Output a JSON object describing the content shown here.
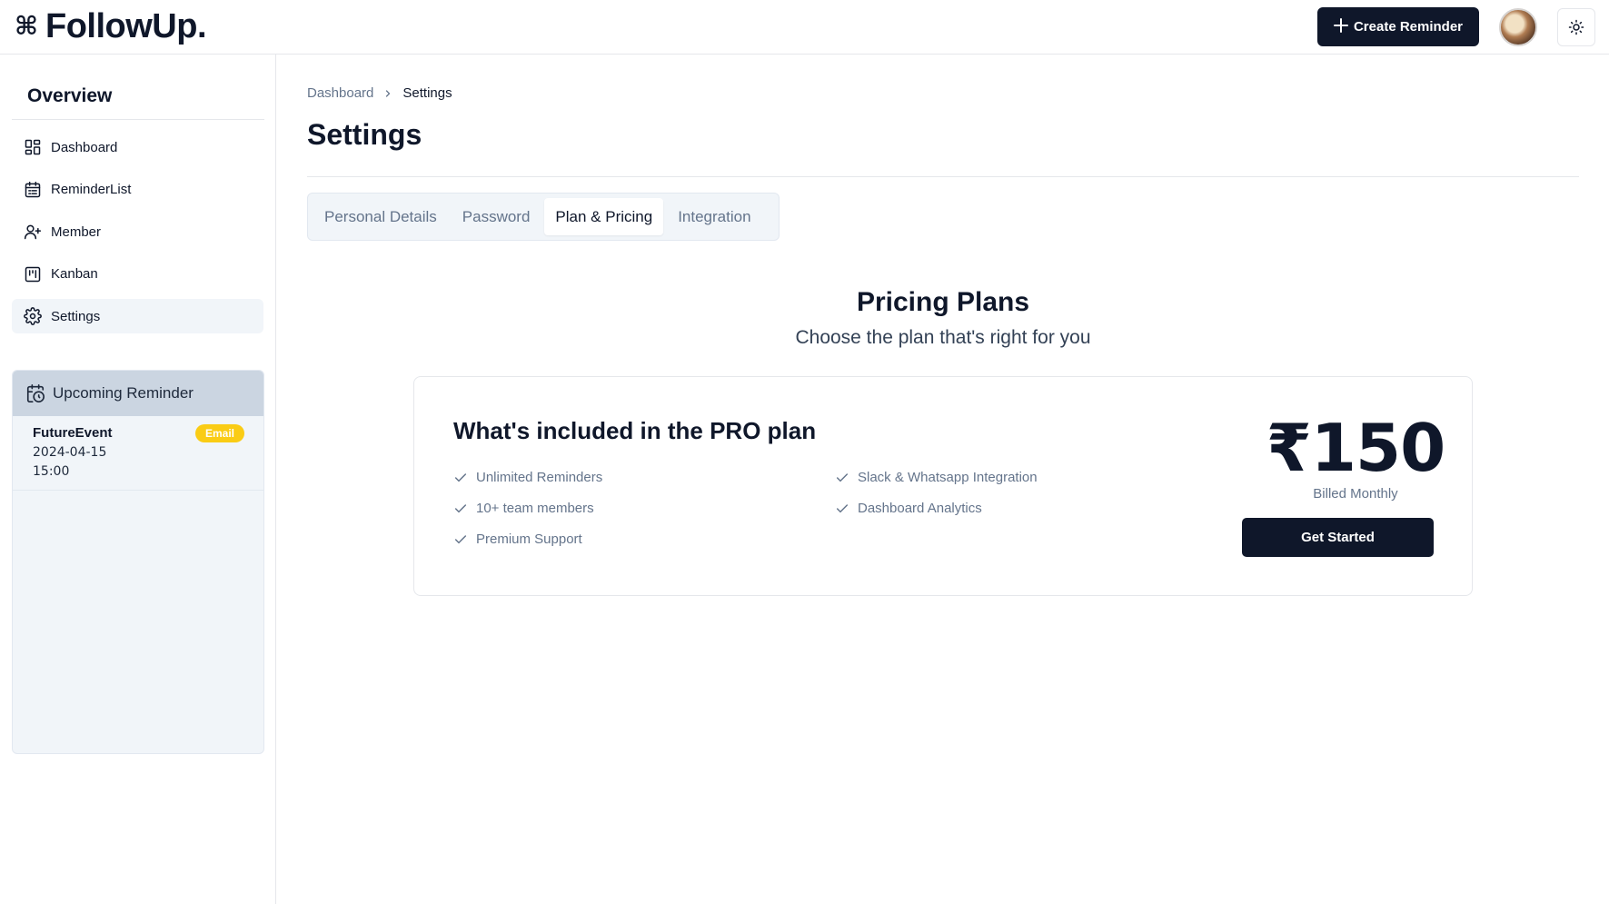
{
  "header": {
    "brand_symbol": "⌘",
    "brand_name": "FollowUp.",
    "create_button_icon": "plus-icon",
    "create_button_label": "Create Reminder",
    "theme_toggle_icon": "sun-icon"
  },
  "sidebar": {
    "title": "Overview",
    "items": [
      {
        "label": "Dashboard",
        "icon": "dashboard-icon"
      },
      {
        "label": "ReminderList",
        "icon": "calendar-list-icon"
      },
      {
        "label": "Member",
        "icon": "user-plus-icon"
      },
      {
        "label": "Kanban",
        "icon": "kanban-icon"
      },
      {
        "label": "Settings",
        "icon": "gear-icon",
        "active": true
      }
    ],
    "upcoming": {
      "title": "Upcoming Reminder",
      "icon": "calendar-clock-icon",
      "items": [
        {
          "name": "FutureEvent",
          "date": "2024-04-15",
          "time": "15:00",
          "badge": "Email"
        }
      ]
    }
  },
  "main": {
    "breadcrumb": {
      "parent": "Dashboard",
      "current": "Settings"
    },
    "page_title": "Settings",
    "tabs": [
      {
        "label": "Personal Details"
      },
      {
        "label": "Password"
      },
      {
        "label": "Plan & Pricing",
        "active": true
      },
      {
        "label": "Integration"
      }
    ],
    "pricing": {
      "title": "Pricing Plans",
      "subtitle": "Choose the plan that's right for you",
      "plan_heading": "What's included in the PRO plan",
      "features": [
        "Unlimited Reminders",
        "10+ team members",
        "Premium Support",
        "Slack & Whatsapp Integration",
        "Dashboard Analytics"
      ],
      "price": "₹150",
      "billing": "Billed Monthly",
      "cta": "Get Started"
    }
  },
  "colors": {
    "primary": "#0f172a",
    "muted_text": "#64748b",
    "active_bg": "#f1f5f9",
    "upcoming_header": "#cbd5e1",
    "badge": "#facc15"
  }
}
